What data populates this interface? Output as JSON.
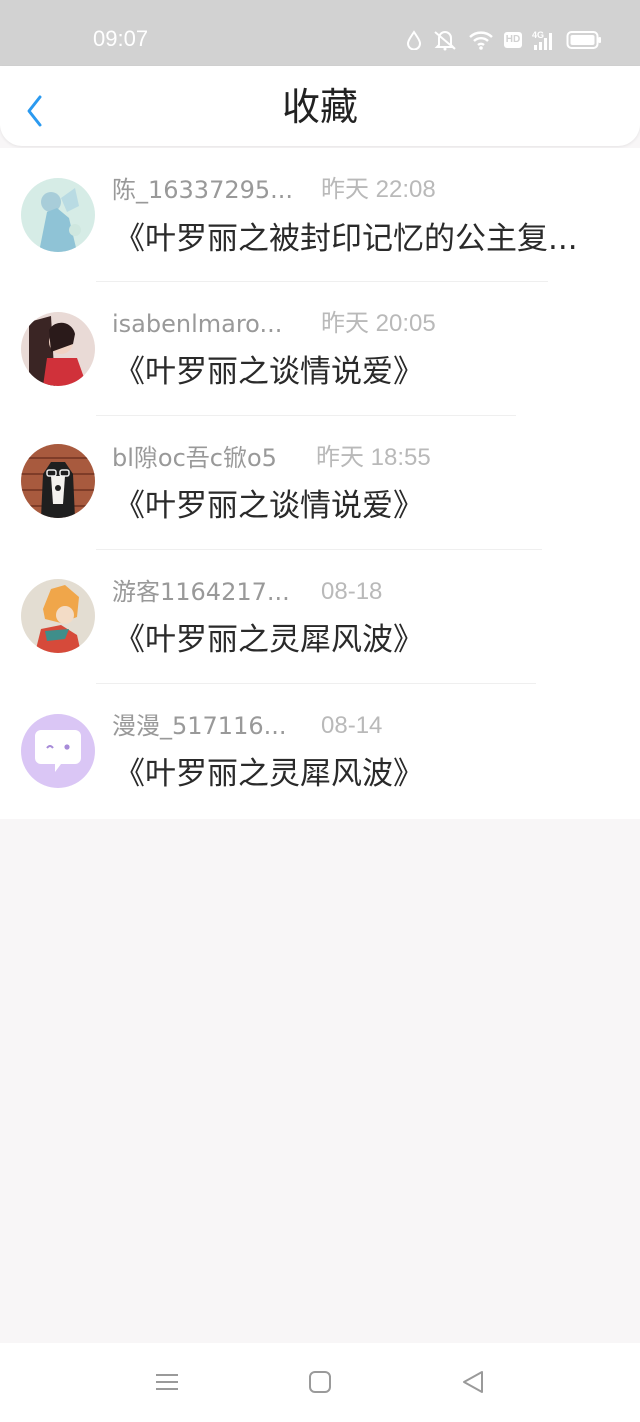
{
  "status_bar": {
    "time": "09:07",
    "icons": [
      "drop-icon",
      "mute-bell-icon",
      "wifi-icon",
      "hd-icon",
      "4g-signal-icon",
      "battery-icon"
    ],
    "hd_label": "HD",
    "network_label": "4G"
  },
  "header": {
    "title": "收藏",
    "back_icon": "chevron-left-icon",
    "accent_color": "#2b9af0"
  },
  "favorites": [
    {
      "user": "陈_16337295...",
      "time": "昨天 22:08",
      "book": "《叶罗丽之被封印记忆的公主复..."
    },
    {
      "user": "isabenlmaro...",
      "time": "昨天 20:05",
      "book": "《叶罗丽之谈情说爱》"
    },
    {
      "user": "bl隙oc吾c锨o5",
      "time": "昨天 18:55",
      "book": "《叶罗丽之谈情说爱》"
    },
    {
      "user": "游客1164217...",
      "time": "08-18",
      "book": "《叶罗丽之灵犀风波》"
    },
    {
      "user": "漫漫_517116...",
      "time": "08-14",
      "book": "《叶罗丽之灵犀风波》"
    }
  ],
  "nav_bar": {
    "buttons": [
      "menu-icon",
      "home-square-icon",
      "back-triangle-icon"
    ]
  }
}
